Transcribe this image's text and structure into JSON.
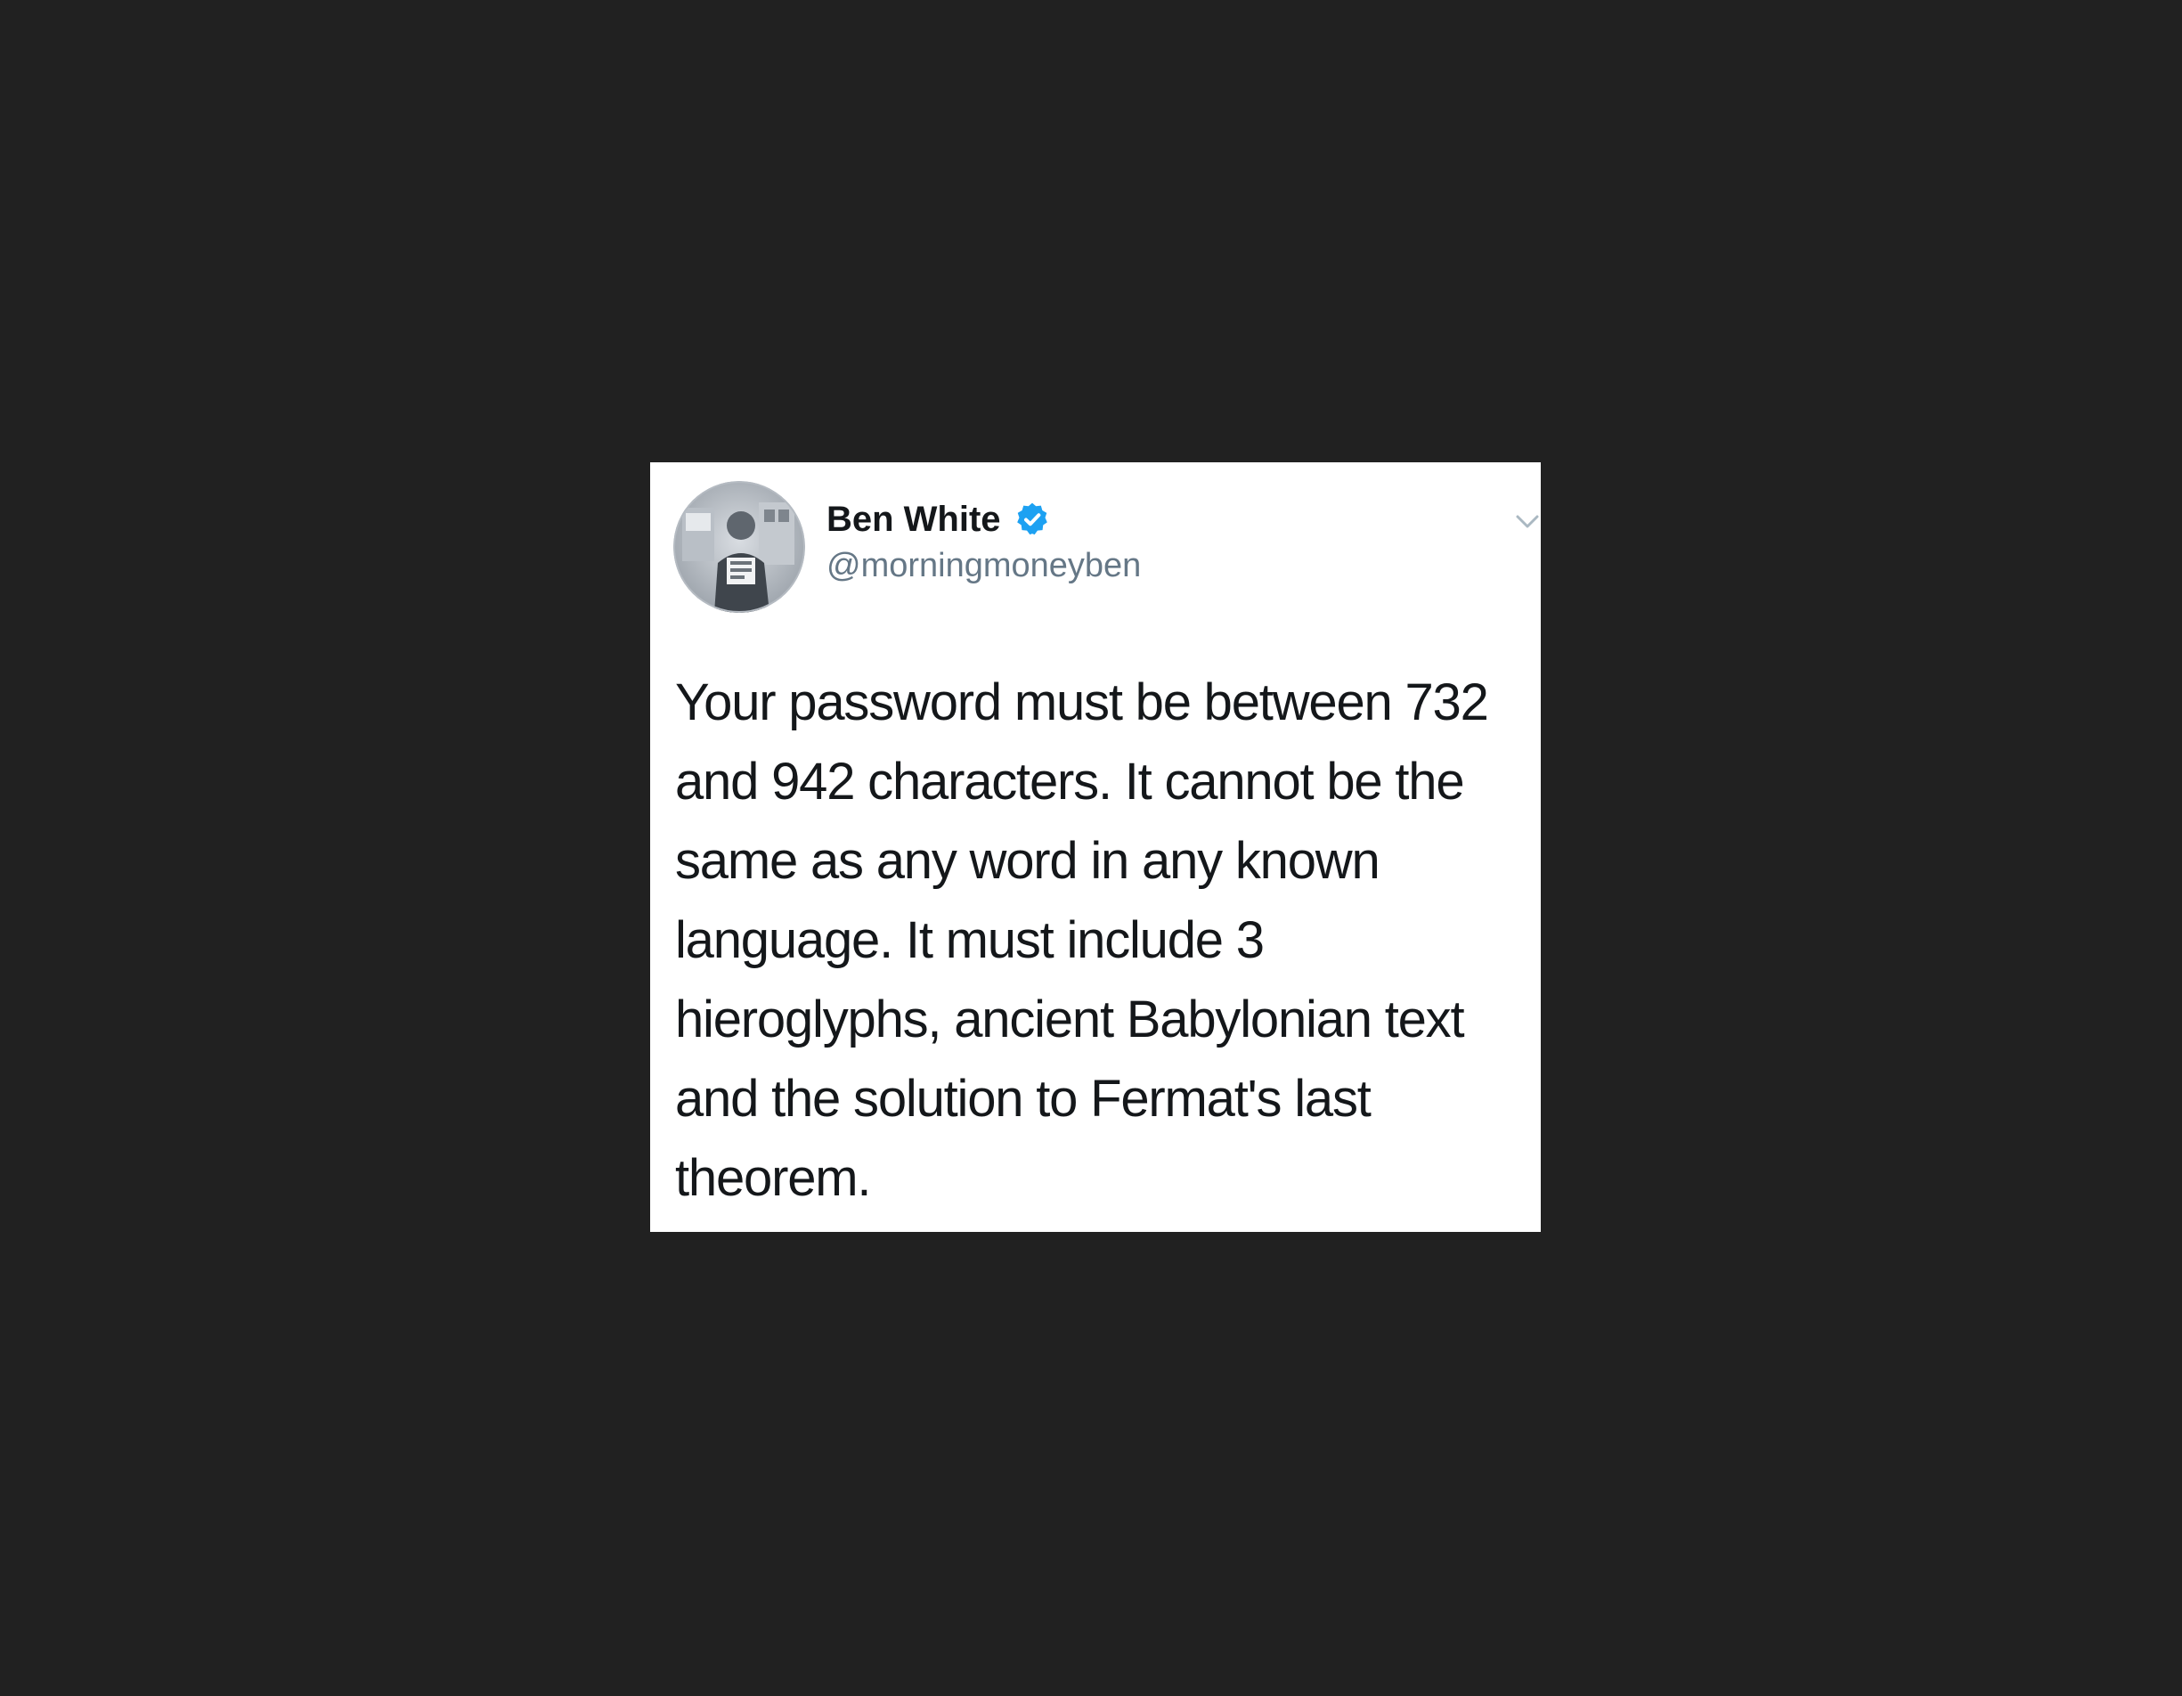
{
  "tweet": {
    "author": {
      "display_name": "Ben White",
      "handle": "@morningmoneyben",
      "verified": true,
      "avatar_icon": "profile-photo-grayscale"
    },
    "text_lines": [
      "Your password must be between 732",
      "and 942 characters. It cannot be the",
      "same as any word in any known",
      "language. It must include 3",
      "hieroglyphs, ancient Babylonian text",
      "and the solution to Fermat's last",
      "theorem."
    ],
    "menu_icon": "chevron-down-icon"
  },
  "colors": {
    "page_background": "#212121",
    "card_background": "#ffffff",
    "text_primary": "#14171a",
    "text_secondary": "#657786",
    "verified_badge": "#1da1f2"
  }
}
